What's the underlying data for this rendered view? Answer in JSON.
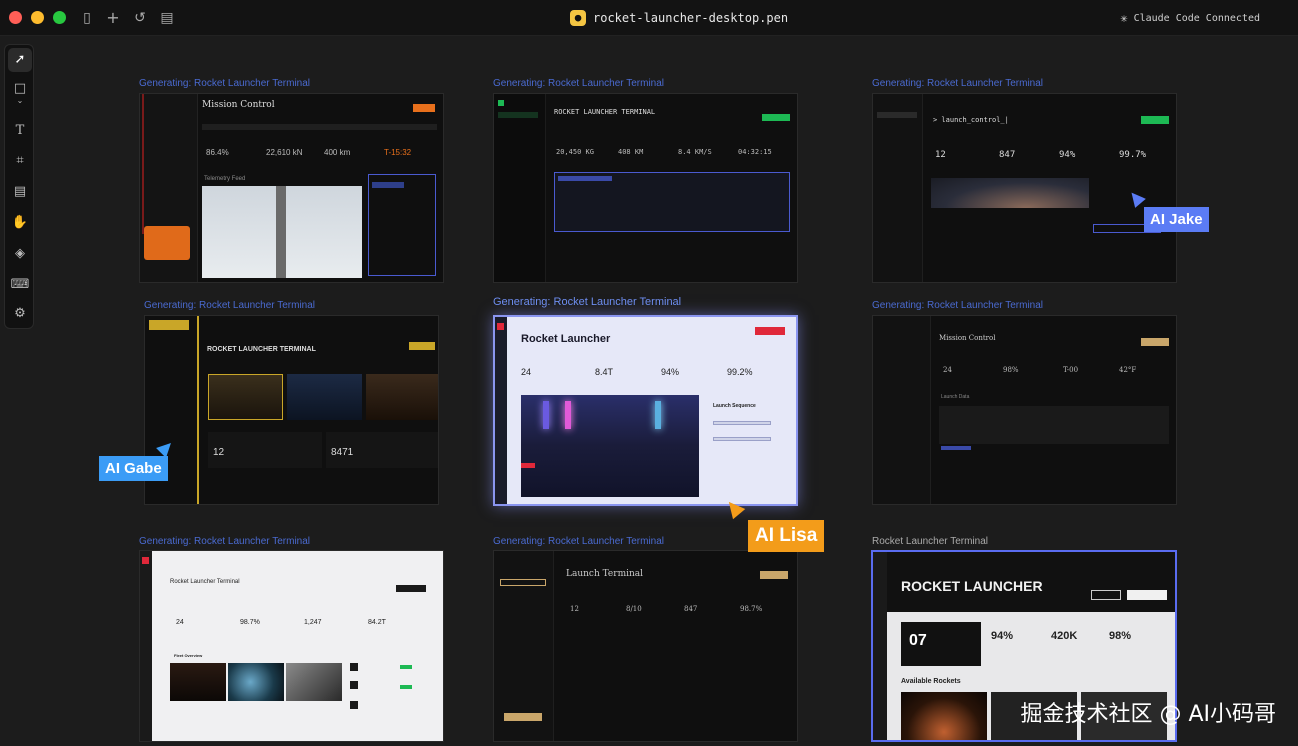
{
  "window": {
    "file_name": "rocket-launcher-desktop.pen",
    "status": "Claude Code Connected"
  },
  "toolbar": {
    "tools": [
      "select-tool",
      "frame-tool",
      "text-tool",
      "artboard-tool",
      "note-tool",
      "hand-tool",
      "component-tool",
      "keyboard-tool",
      "settings-tool"
    ]
  },
  "frames": {
    "f1": {
      "label": "Generating: Rocket Launcher Terminal",
      "title": "Mission Control",
      "stats": [
        "86.4%",
        "22,610 kN",
        "400 km",
        "T-15:32"
      ],
      "section": "Telemetry Feed"
    },
    "f2": {
      "label": "Generating: Rocket Launcher Terminal",
      "title": "ROCKET LAUNCHER TERMINAL",
      "stats": [
        "20,450 KG",
        "408 KM",
        "8.4 KM/S",
        "04:32:15"
      ]
    },
    "f3": {
      "label": "Generating: Rocket Launcher Terminal",
      "title": "> launch_control_|",
      "stats": [
        "12",
        "847",
        "94%",
        "99.7%"
      ]
    },
    "f4": {
      "label": "Generating: Rocket Launcher Terminal",
      "title": "ROCKET LAUNCHER TERMINAL",
      "stats": [
        "12",
        "8471"
      ]
    },
    "f5": {
      "label": "Generating: Rocket Launcher Terminal",
      "title": "Rocket Launcher",
      "stats": [
        "24",
        "8.4T",
        "94%",
        "99.2%"
      ],
      "panel": "Launch Sequence"
    },
    "f6": {
      "label": "Generating: Rocket Launcher Terminal",
      "title": "Mission Control",
      "stats": [
        "24",
        "98%",
        "T-00",
        "42°F"
      ],
      "section": "Launch Data"
    },
    "f7": {
      "label": "Generating: Rocket Launcher Terminal",
      "title": "Rocket Launcher Terminal",
      "stats": [
        "24",
        "98.7%",
        "1,247",
        "84.2T"
      ],
      "section": "Fleet Overview"
    },
    "f8": {
      "label": "Generating: Rocket Launcher Terminal",
      "title": "Launch Terminal",
      "stats": [
        "12",
        "8/10",
        "847",
        "98.7%"
      ]
    },
    "f9": {
      "label": "Rocket Launcher Terminal",
      "title": "ROCKET LAUNCHER",
      "big": "07",
      "stats": [
        "94%",
        "420K",
        "98%"
      ],
      "section": "Available Rockets"
    }
  },
  "cursors": {
    "jake": {
      "name": "AI Jake",
      "color": "#5b7cf5"
    },
    "gabe": {
      "name": "AI Gabe",
      "color": "#3b9cf6"
    },
    "lisa": {
      "name": "AI Lisa",
      "color": "#f39c1a"
    }
  },
  "watermark": "掘金技术社区 @ AI小码哥"
}
